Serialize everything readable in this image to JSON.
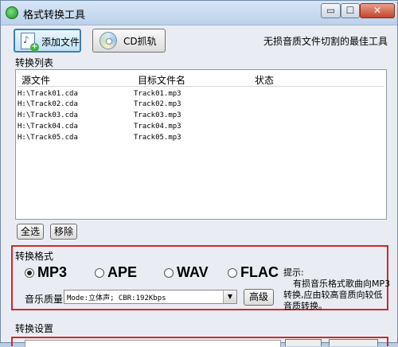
{
  "window": {
    "title": "格式转换工具",
    "controls": {
      "minimize": "▭",
      "maximize": "☐",
      "close": "✕"
    }
  },
  "toolbar": {
    "add_file_label": "添加文件",
    "cd_rip_label": "CD抓轨",
    "slogan": "无损音质文件切割的最佳工具"
  },
  "file_list": {
    "section_label": "转换列表",
    "columns": [
      "源文件",
      "目标文件名",
      "状态"
    ],
    "rows": [
      {
        "source": "H:\\Track01.cda",
        "target": "Track01.mp3",
        "status": ""
      },
      {
        "source": "H:\\Track02.cda",
        "target": "Track02.mp3",
        "status": ""
      },
      {
        "source": "H:\\Track03.cda",
        "target": "Track03.mp3",
        "status": ""
      },
      {
        "source": "H:\\Track04.cda",
        "target": "Track04.mp3",
        "status": ""
      },
      {
        "source": "H:\\Track05.cda",
        "target": "Track05.mp3",
        "status": ""
      }
    ],
    "select_all_label": "全选",
    "remove_label": "移除"
  },
  "format": {
    "section_label": "转换格式",
    "options": [
      "MP3",
      "APE",
      "WAV",
      "FLAC"
    ],
    "selected": "MP3",
    "quality_label": "音乐质量",
    "quality_value": "Mode:立体声; CBR:192Kbps",
    "advanced_label": "高级",
    "tip_title": "提示:",
    "tip_lines": [
      "有损音乐格式歌曲向MP3",
      "转换,应由较高音质向较低",
      "音质转换。"
    ]
  },
  "settings": {
    "section_label": "转换设置"
  },
  "colors": {
    "highlight_border": "#d12a2a",
    "window_bg": "#e9edf3",
    "titlebar": "#bcd1ea"
  }
}
